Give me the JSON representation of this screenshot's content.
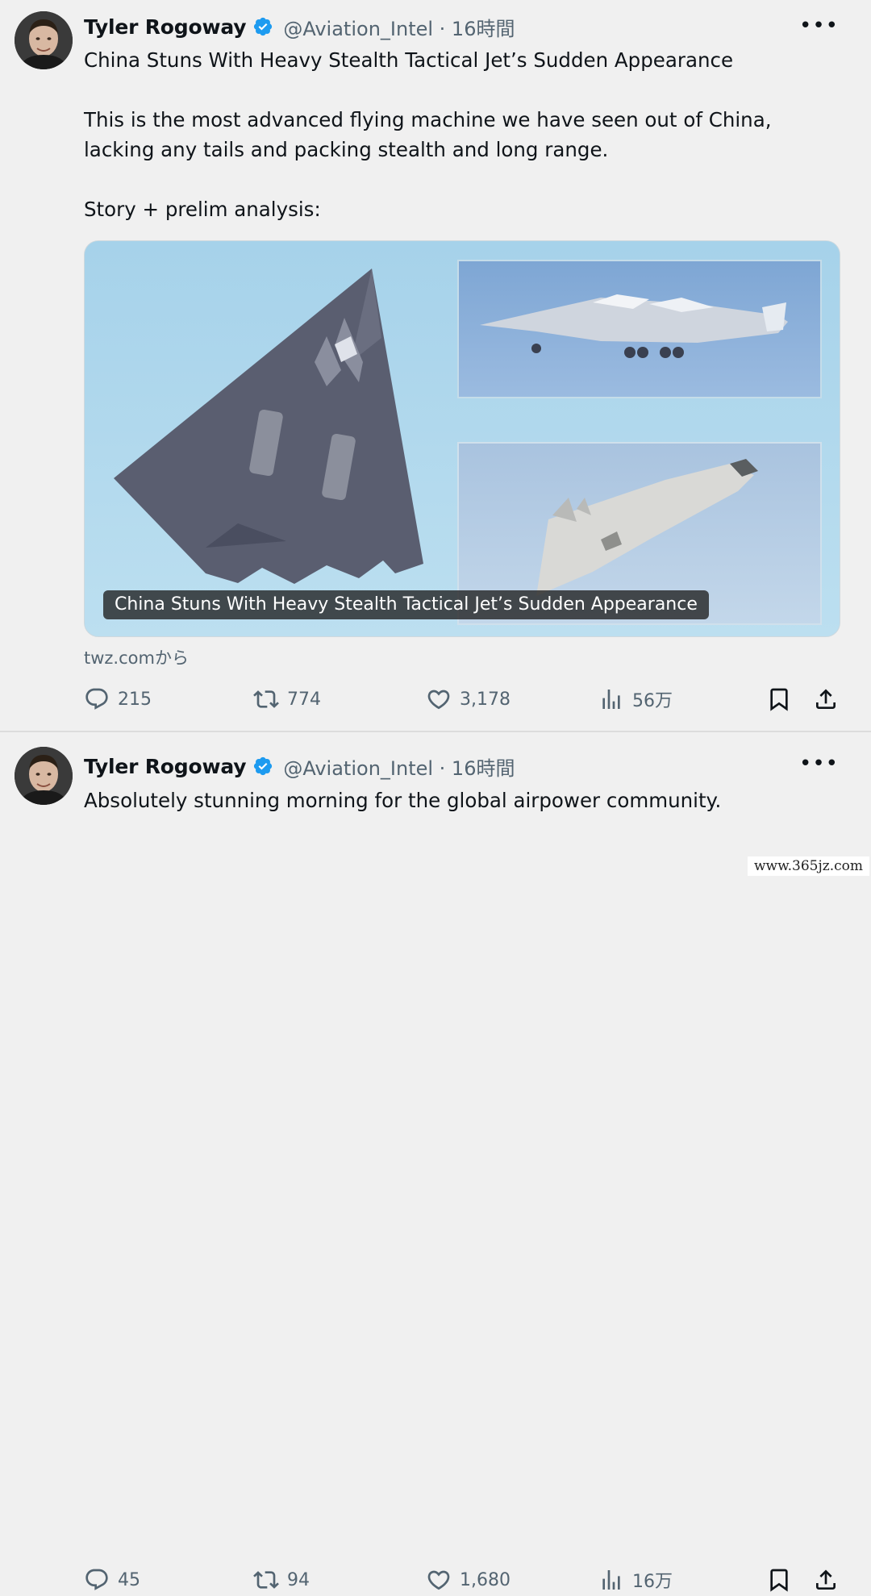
{
  "tweets": [
    {
      "author_name": "Tyler Rogoway",
      "handle_time": "@Aviation_Intel · 16時間",
      "more_label": "•••",
      "text_lines": [
        "China Stuns With Heavy Stealth Tactical Jet’s Sudden Appearance",
        "This is the most advanced flying machine we have seen out of China, lacking any tails and packing stealth and long range.",
        "Story + prelim analysis:"
      ],
      "card_caption": "China Stuns With Heavy Stealth Tactical Jet’s Sudden Appearance",
      "card_source": "twz.comから",
      "replies": "215",
      "reposts": "774",
      "likes": "3,178",
      "views": "56万"
    },
    {
      "author_name": "Tyler Rogoway",
      "handle_time": "@Aviation_Intel · 16時間",
      "more_label": "•••",
      "text_lines": [
        "Absolutely stunning morning for the global airpower community."
      ],
      "replies": "45",
      "reposts": "94",
      "likes": "1,680",
      "views": "16万"
    }
  ],
  "watermark": "www.365jz.com",
  "colors": {
    "verified": "#1d9bf0",
    "secondary_text": "#536471",
    "background": "#f0f0f0"
  },
  "icons": [
    "avatar",
    "verified-badge-icon",
    "more-icon",
    "reply-icon",
    "repost-icon",
    "like-icon",
    "views-icon",
    "bookmark-icon",
    "share-icon"
  ]
}
